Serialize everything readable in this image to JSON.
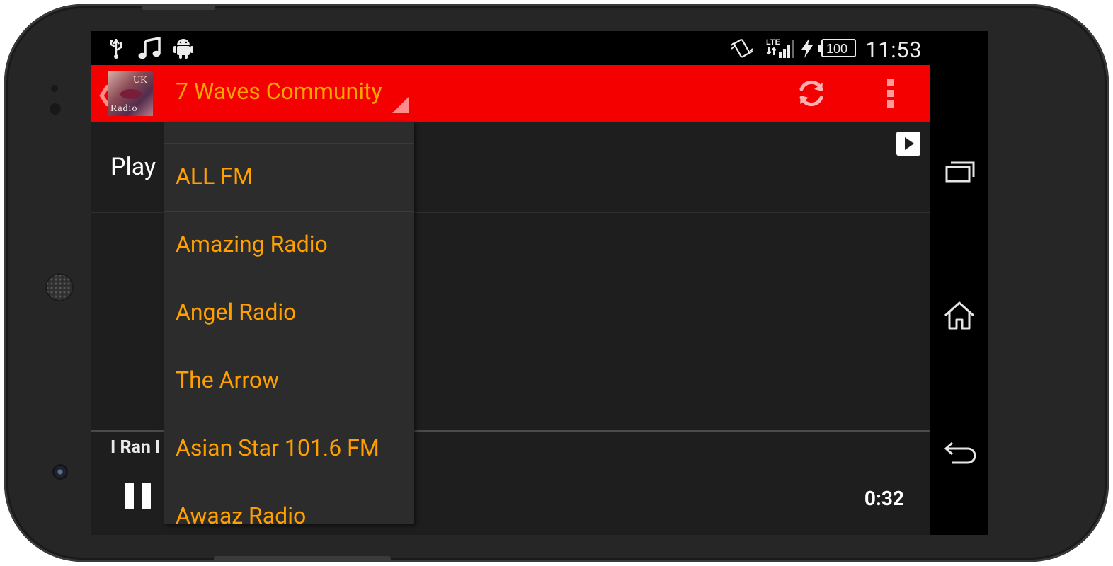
{
  "status_bar": {
    "left_icons": [
      "usb-icon",
      "music-note-icon",
      "android-icon"
    ],
    "right_icons": [
      "vibrate-icon",
      "lte-signal-icon",
      "charging-icon",
      "battery-icon"
    ],
    "battery_level": "100",
    "network": "LTE",
    "time": "11:53"
  },
  "action_bar": {
    "color": "#f40000",
    "logo_text": "Radio",
    "logo_uk": "UK",
    "title": "7 Waves Community",
    "refresh_icon": "refresh-icon",
    "overflow_icon": "overflow-menu-icon"
  },
  "main": {
    "play_label": "Play",
    "play_icon": "play-icon",
    "track_title": "I Ran I",
    "elapsed_time": "0:32",
    "pause_icon": "pause-icon"
  },
  "dropdown": {
    "items": [
      "ALL FM",
      "Amazing Radio",
      "Angel Radio",
      "The Arrow",
      "Asian Star 101.6 FM",
      "Awaaz Radio"
    ],
    "text_color": "#ffa000"
  },
  "nav_bar": {
    "buttons": [
      "recent-apps-icon",
      "home-icon",
      "back-icon"
    ]
  }
}
